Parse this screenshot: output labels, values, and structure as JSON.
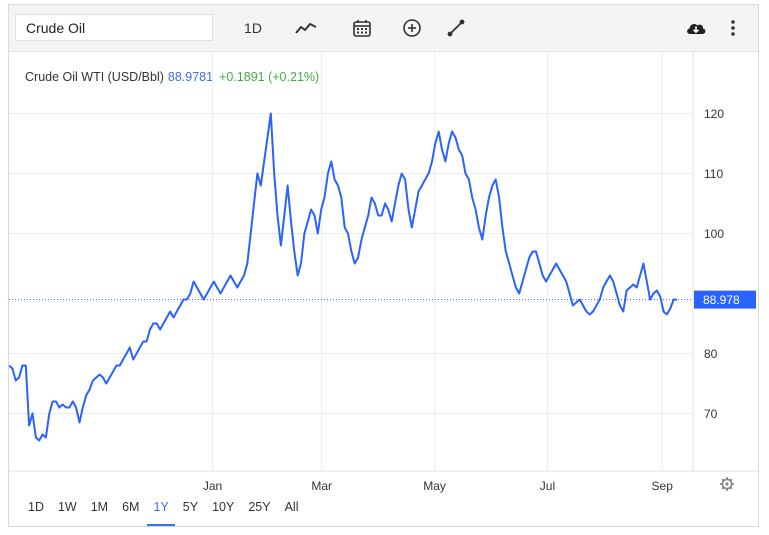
{
  "toolbar": {
    "search_value": "Crude Oil",
    "interval_label": "1D"
  },
  "legend": {
    "name": "Crude Oil WTI (USD/Bbl)",
    "price": "88.9781",
    "change": "+0.1891 (+0.21%)"
  },
  "ranges": [
    "1D",
    "1W",
    "1M",
    "6M",
    "1Y",
    "5Y",
    "10Y",
    "25Y",
    "All"
  ],
  "active_range": "1Y",
  "colors": {
    "line": "#2962ff",
    "accent": "#3d6ee8",
    "positive": "#3fae3f"
  },
  "chart_data": {
    "type": "line",
    "title": "Crude Oil WTI (USD/Bbl)",
    "xlabel": "",
    "ylabel": "",
    "ylim": [
      60,
      130
    ],
    "y_ticks": [
      70,
      80,
      100,
      110,
      120
    ],
    "x_ticks": [
      "Jan",
      "Mar",
      "May",
      "Jul",
      "Sep"
    ],
    "last_value_label": "88.978",
    "grid": true,
    "series": [
      {
        "name": "Crude Oil WTI",
        "x_start": "2021-09-13",
        "x_end": "2022-09-09",
        "values": [
          78.0,
          77.5,
          75.5,
          76.0,
          78.0,
          78.0,
          68.0,
          70.0,
          66.0,
          65.5,
          66.5,
          66.0,
          70.0,
          72.0,
          72.0,
          71.0,
          71.5,
          71.0,
          71.0,
          72.0,
          71.0,
          68.5,
          71.0,
          73.0,
          74.0,
          75.5,
          76.0,
          76.5,
          76.0,
          75.0,
          76.0,
          77.0,
          78.0,
          78.0,
          79.0,
          80.0,
          81.0,
          79.0,
          80.0,
          81.0,
          82.0,
          82.0,
          84.0,
          85.0,
          85.0,
          84.0,
          85.0,
          86.0,
          87.0,
          86.0,
          87.0,
          88.0,
          89.0,
          89.0,
          90.0,
          92.0,
          91.0,
          90.0,
          89.0,
          90.0,
          91.0,
          92.0,
          91.0,
          90.0,
          91.0,
          92.0,
          93.0,
          92.0,
          91.0,
          92.0,
          93.0,
          95.0,
          100.0,
          105.0,
          110.0,
          108.0,
          112.0,
          116.0,
          120.0,
          110.0,
          103.0,
          98.0,
          103.0,
          108.0,
          102.0,
          97.0,
          93.0,
          95.0,
          100.0,
          102.0,
          104.0,
          103.0,
          100.0,
          104.0,
          106.0,
          110.0,
          112.0,
          109.0,
          108.0,
          106.0,
          101.0,
          100.0,
          97.0,
          95.0,
          96.0,
          99.0,
          101.0,
          103.0,
          106.0,
          105.0,
          103.0,
          103.0,
          105.0,
          104.0,
          102.0,
          105.0,
          108.0,
          110.0,
          109.0,
          104.0,
          101.0,
          104.0,
          107.0,
          108.0,
          109.0,
          110.0,
          112.0,
          115.0,
          117.0,
          114.0,
          112.0,
          115.0,
          117.0,
          116.0,
          114.0,
          113.0,
          110.0,
          109.0,
          106.0,
          104.0,
          101.0,
          99.0,
          103.0,
          106.0,
          108.0,
          109.0,
          106.0,
          101.0,
          97.0,
          95.0,
          93.0,
          91.0,
          90.0,
          92.0,
          94.0,
          96.0,
          97.0,
          97.0,
          95.0,
          93.0,
          92.0,
          93.0,
          94.0,
          95.0,
          94.0,
          93.0,
          92.0,
          90.0,
          88.0,
          88.5,
          89.0,
          88.0,
          87.0,
          86.5,
          87.0,
          88.0,
          89.0,
          91.0,
          92.0,
          93.0,
          92.0,
          90.0,
          88.0,
          87.0,
          90.5,
          91.0,
          91.5,
          91.0,
          93.0,
          95.0,
          92.0,
          89.0,
          90.0,
          90.5,
          89.5,
          87.0,
          86.5,
          87.5,
          88.978,
          88.978
        ]
      }
    ]
  }
}
